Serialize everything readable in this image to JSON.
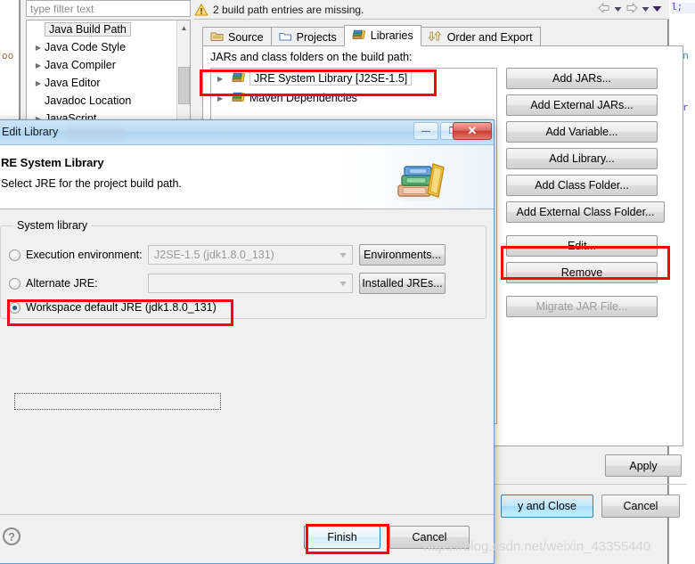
{
  "background_editor": {
    "left_fragments": [
      "oo"
    ],
    "right_fragments": [
      "l;",
      "ran",
      "ntr"
    ]
  },
  "preferences": {
    "filter": {
      "placeholder": "type filter text",
      "value": ""
    },
    "warning": {
      "icon": "warning-icon",
      "text": "2 build path entries are missing."
    },
    "nav": {
      "back": "back-arrow-icon",
      "back_menu": "chevron-down-icon",
      "forward": "forward-arrow-icon",
      "forward_menu": "chevron-down-icon",
      "view_menu": "chevron-down-icon"
    },
    "tree": [
      {
        "label": "Java Build Path",
        "expandable": false,
        "selected": true
      },
      {
        "label": "Java Code Style",
        "expandable": true,
        "selected": false
      },
      {
        "label": "Java Compiler",
        "expandable": true,
        "selected": false
      },
      {
        "label": "Java Editor",
        "expandable": true,
        "selected": false
      },
      {
        "label": "Javadoc Location",
        "expandable": false,
        "selected": false
      },
      {
        "label": "JavaScript",
        "expandable": true,
        "selected": false
      }
    ],
    "tabs": [
      {
        "label": "Source",
        "icon": "source-folder-icon",
        "active": false
      },
      {
        "label": "Projects",
        "icon": "projects-folder-icon",
        "active": false
      },
      {
        "label": "Libraries",
        "icon": "library-books-icon",
        "active": true
      },
      {
        "label": "Order and Export",
        "icon": "order-export-icon",
        "active": false
      }
    ],
    "libraries_tab": {
      "caption": "JARs and class folders on the build path:",
      "entries": [
        {
          "label": "JRE System Library [J2SE-1.5]",
          "icon": "library-books-icon",
          "selected": true
        },
        {
          "label": "Maven Dependencies",
          "icon": "library-books-icon",
          "selected": false
        }
      ],
      "buttons": [
        {
          "label": "Add JARs...",
          "mnemonic": "J",
          "enabled": true
        },
        {
          "label": "Add External JARs...",
          "mnemonic": "x",
          "enabled": true
        },
        {
          "label": "Add Variable...",
          "mnemonic": "V",
          "enabled": true
        },
        {
          "label": "Add Library...",
          "mnemonic": "b",
          "enabled": true
        },
        {
          "label": "Add Class Folder...",
          "mnemonic": "C",
          "enabled": true
        },
        {
          "label": "Add External Class Folder...",
          "mnemonic": "d",
          "enabled": true
        },
        {
          "label": "Edit...",
          "mnemonic": "E",
          "enabled": true
        },
        {
          "label": "Remove",
          "mnemonic": "R",
          "enabled": true
        },
        {
          "label": "Migrate JAR File...",
          "mnemonic": "M",
          "enabled": false
        }
      ]
    },
    "apply_label": "Apply",
    "apply_and_close_label": "y and Close",
    "cancel_label": "Cancel"
  },
  "edit_library_dialog": {
    "window_title": "Edit Library",
    "window_buttons": {
      "minimize": "minimize-icon",
      "maximize": "maximize-icon",
      "close": "close-icon"
    },
    "heading": "RE System Library",
    "subheading": "Select JRE for the project build path.",
    "header_icon": "books-icon",
    "group_label": "System library",
    "options": [
      {
        "label": "Execution environment:",
        "mnemonic": "x",
        "selected": false,
        "combo_value": "J2SE-1.5 (jdk1.8.0_131)",
        "side_button": "Environments...",
        "side_mnemonic": "o"
      },
      {
        "label": "Alternate JRE:",
        "mnemonic": "J",
        "selected": false,
        "combo_value": "",
        "side_button": "Installed JREs...",
        "side_mnemonic": "I"
      },
      {
        "label": "Workspace default JRE (jdk1.8.0_131)",
        "mnemonic": "d",
        "selected": true
      }
    ],
    "help_icon": "help-icon",
    "finish_label": "Finish",
    "cancel_label": "Cancel"
  },
  "annotations": {
    "highlight_color": "#fb0606",
    "boxes": [
      "jre-system-library-entry",
      "edit-button",
      "workspace-default-jre-radio",
      "finish-button"
    ]
  },
  "watermark": {
    "text": "https://blog.csdn.net/weixin_43355440"
  }
}
